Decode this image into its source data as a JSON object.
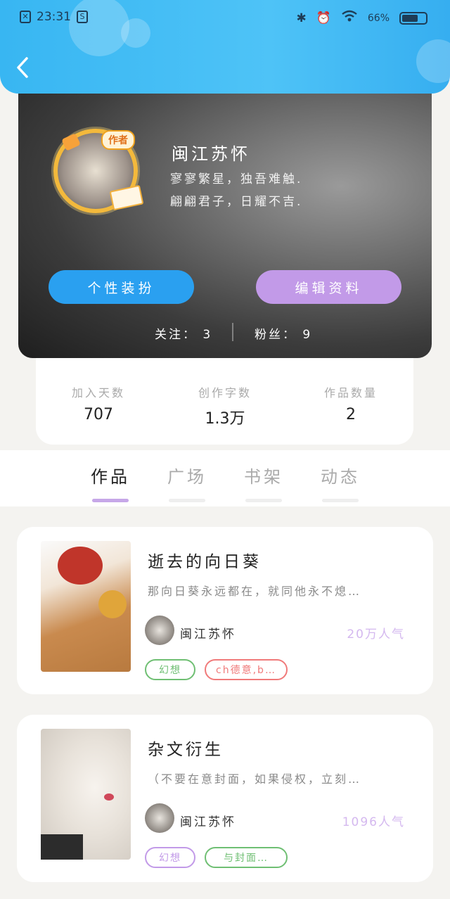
{
  "status_bar": {
    "time": "23:31",
    "battery": "66%"
  },
  "profile": {
    "badge": "作者",
    "name": "闽江苏怀",
    "bio_line1": "寥寥繁星，独吾难触.",
    "bio_line2": "翩翩君子，日耀不吉.",
    "dress_up_button": "个性装扮",
    "edit_button": "编辑资料",
    "following_label": "关注：",
    "following_count": "3",
    "followers_label": "粉丝：",
    "followers_count": "9"
  },
  "stats": [
    {
      "label": "加入天数",
      "value": "707"
    },
    {
      "label": "创作字数",
      "value": "1.3万"
    },
    {
      "label": "作品数量",
      "value": "2"
    }
  ],
  "tabs": [
    {
      "label": "作品",
      "active": true
    },
    {
      "label": "广场",
      "active": false
    },
    {
      "label": "书架",
      "active": false
    },
    {
      "label": "动态",
      "active": false
    }
  ],
  "works": [
    {
      "title": "逝去的向日葵",
      "description": "那向日葵永远都在，就同他永不熄…",
      "author": "闽江苏怀",
      "popularity": "20万人气",
      "tags": [
        {
          "label": "幻想",
          "color": "#6fbf73"
        },
        {
          "label": "ch德意,b…",
          "color": "#f07a7a"
        }
      ]
    },
    {
      "title": "杂文衍生",
      "description": "（不要在意封面，如果侵权，立刻…",
      "author": "闽江苏怀",
      "popularity": "1096人气",
      "tags": [
        {
          "label": "幻想",
          "color": "#c29ae8"
        },
        {
          "label": "与封面…",
          "color": "#6fbf73"
        }
      ]
    }
  ],
  "colors": {
    "header": "#38b6f2",
    "accent_blue": "#2aa0f0",
    "accent_purple": "#c29ae8",
    "tab_indicator": "#c6a7e8"
  }
}
